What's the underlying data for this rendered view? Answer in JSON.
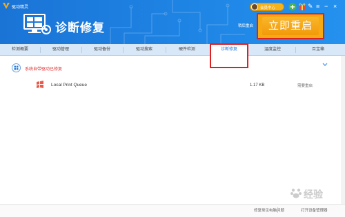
{
  "app": {
    "name": "驱动精灵"
  },
  "header": {
    "title": "诊断修复",
    "last_restart_label": "稍后重启",
    "restart_button": "立即重启",
    "member_label": "会员中心"
  },
  "tabs": [
    {
      "label": "检测概要"
    },
    {
      "label": "驱动管理"
    },
    {
      "label": "驱动备份"
    },
    {
      "label": "驱动搜索"
    },
    {
      "label": "硬件检测"
    },
    {
      "label": "诊断修复"
    },
    {
      "label": "温度监控"
    },
    {
      "label": "百宝箱"
    }
  ],
  "section": {
    "title": "系统自带驱动已修复"
  },
  "items": [
    {
      "name": "Local Print Queue",
      "size": "1.17 KB",
      "status": "需要重启"
    }
  ],
  "footer": {
    "link1": "修复常见电脑问题",
    "link2": "打开设备管理器"
  },
  "watermark": {
    "text": "经验"
  },
  "colors": {
    "header_blue": "#1f86e6",
    "accent_orange": "#f7a914",
    "highlight_red": "#e02020"
  }
}
